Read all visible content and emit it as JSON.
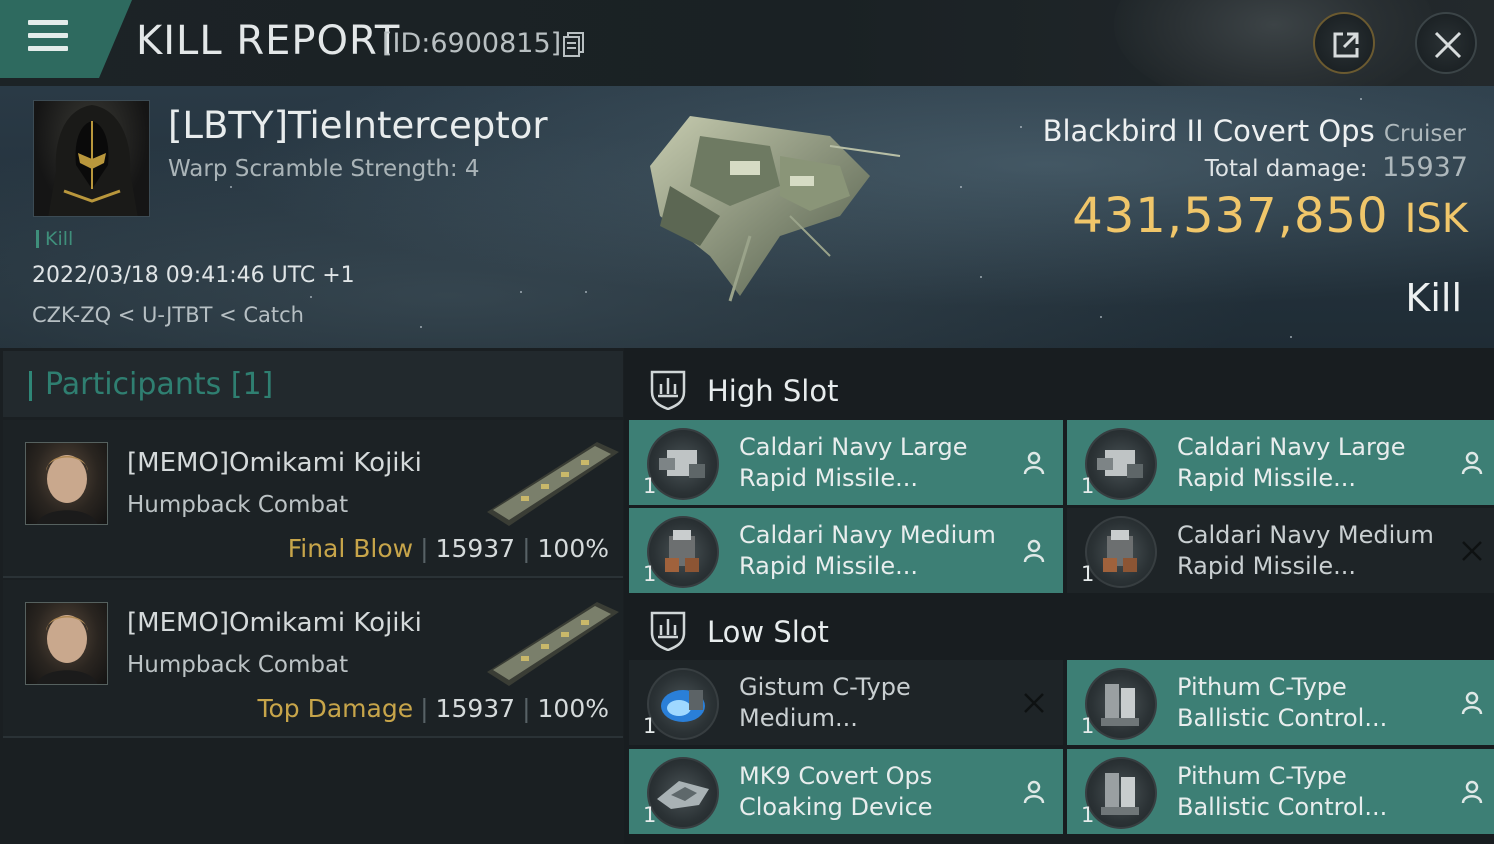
{
  "header": {
    "title": "KILL REPORT",
    "report_id": "[ID:6900815]"
  },
  "victim": {
    "pilot": "[LBTY]TieInterceptor",
    "warp_scramble": "Warp Scramble Strength: 4",
    "kill_tag": "Kill",
    "timestamp": "2022/03/18 09:41:46 UTC +1",
    "location": "CZK-ZQ < U-JTBT < Catch",
    "ship_name": "Blackbird II Covert Ops",
    "ship_class": "Cruiser",
    "total_damage_label": "Total damage:",
    "total_damage": "15937",
    "isk_value": "431,537,850",
    "isk_unit": "ISK",
    "result": "Kill"
  },
  "participants": {
    "header": "Participants [1]",
    "items": [
      {
        "name": "[MEMO]Omikami Kojiki",
        "ship": "Humpback Combat",
        "tag": "Final Blow",
        "damage": "15937",
        "percent": "100%"
      },
      {
        "name": "[MEMO]Omikami Kojiki",
        "ship": "Humpback Combat",
        "tag": "Top Damage",
        "damage": "15937",
        "percent": "100%"
      }
    ]
  },
  "slots": {
    "high": {
      "label": "High Slot",
      "modules": [
        {
          "line1": "Caldari Navy Large",
          "line2": "Rapid Missile...",
          "qty": "1",
          "status": "dropped-pilot-icon",
          "state": "fit"
        },
        {
          "line1": "Caldari Navy Large",
          "line2": "Rapid Missile...",
          "qty": "1",
          "status": "dropped-pilot-icon",
          "state": "fit"
        },
        {
          "line1": "Caldari Navy Medium",
          "line2": "Rapid Missile...",
          "qty": "1",
          "status": "dropped-pilot-icon",
          "state": "fit"
        },
        {
          "line1": "Caldari Navy Medium",
          "line2": "Rapid Missile...",
          "qty": "1",
          "status": "destroyed-x-icon",
          "state": "drop"
        }
      ]
    },
    "low": {
      "label": "Low Slot",
      "modules": [
        {
          "line1": "Gistum C-Type",
          "line2": "Medium...",
          "qty": "1",
          "status": "destroyed-x-icon",
          "state": "drop"
        },
        {
          "line1": "Pithum C-Type",
          "line2": "Ballistic Control...",
          "qty": "1",
          "status": "dropped-pilot-icon",
          "state": "fit"
        },
        {
          "line1": "MK9 Covert Ops",
          "line2": "Cloaking Device",
          "qty": "1",
          "status": "dropped-pilot-icon",
          "state": "fit"
        },
        {
          "line1": "Pithum C-Type",
          "line2": "Ballistic Control...",
          "qty": "1",
          "status": "dropped-pilot-icon",
          "state": "fit"
        }
      ]
    }
  },
  "colors": {
    "accent_teal": "#3d7f75",
    "isk_gold": "#f0c66a",
    "tag_gold": "#c7a54a",
    "menu_green": "#2e6a5f"
  }
}
